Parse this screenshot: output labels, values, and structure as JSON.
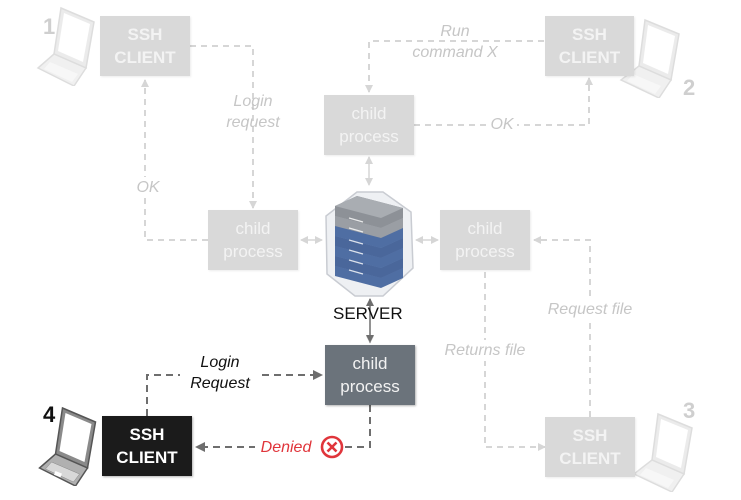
{
  "diagram": {
    "server": {
      "label": "SERVER",
      "icon": "server-rack-icon"
    },
    "clients": [
      {
        "number": "1",
        "label_line1": "SSH",
        "label_line2": "CLIENT",
        "state": "faded"
      },
      {
        "number": "2",
        "label_line1": "SSH",
        "label_line2": "CLIENT",
        "state": "faded"
      },
      {
        "number": "3",
        "label_line1": "SSH",
        "label_line2": "CLIENT",
        "state": "faded"
      },
      {
        "number": "4",
        "label_line1": "SSH",
        "label_line2": "CLIENT",
        "state": "active"
      }
    ],
    "child_processes": [
      {
        "position": "top",
        "line1": "child",
        "line2": "process",
        "state": "faded"
      },
      {
        "position": "left",
        "line1": "child",
        "line2": "process",
        "state": "faded"
      },
      {
        "position": "right",
        "line1": "child",
        "line2": "process",
        "state": "faded"
      },
      {
        "position": "bottom",
        "line1": "child",
        "line2": "process",
        "state": "active"
      }
    ],
    "edge_labels": {
      "c1_login_line1": "Login",
      "c1_login_line2": "request",
      "c1_ok": "OK",
      "c2_run_line1": "Run",
      "c2_run_line2": "command X",
      "c2_ok": "OK",
      "c3_request": "Request file",
      "c3_returns": "Returns file",
      "c4_login_line1": "Login",
      "c4_login_line2": "Request",
      "c4_denied": "Denied"
    },
    "colors": {
      "faded_box": "#d9d9d9",
      "faded_line": "#d6d6d6",
      "active_client": "#1b1b1b",
      "active_child": "#6b737b",
      "active_line": "#6e6e6e",
      "denied": "#e0353b",
      "server_blue": "#4f6ea3"
    }
  }
}
